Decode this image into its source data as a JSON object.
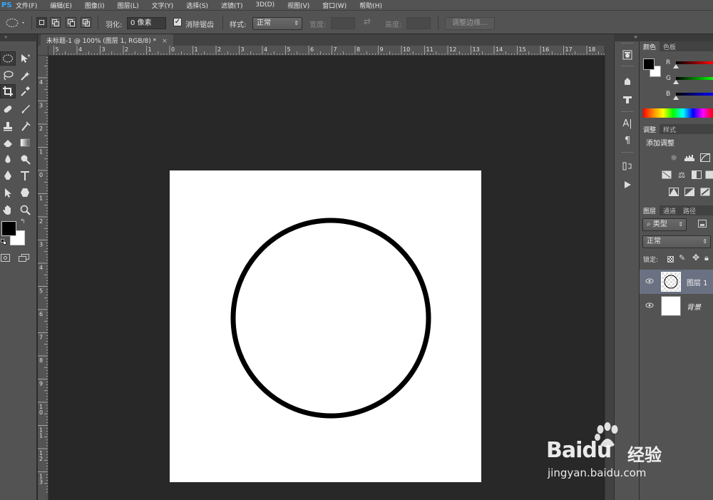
{
  "app": {
    "logo": "PS"
  },
  "menu": [
    "文件(F)",
    "编辑(E)",
    "图像(I)",
    "图层(L)",
    "文字(Y)",
    "选择(S)",
    "滤镜(T)",
    "3D(D)",
    "视图(V)",
    "窗口(W)",
    "帮助(H)"
  ],
  "options": {
    "feather_label": "羽化:",
    "feather_value": "0 像素",
    "antialias_label": "消除锯齿",
    "antialias_checked": true,
    "style_label": "样式:",
    "style_value": "正常",
    "width_label": "宽度:",
    "height_label": "高度:",
    "refine_button": "调整边缘..."
  },
  "document": {
    "tab_title": "未标题-1 @ 100% (图层 1, RGB/8) *",
    "close_glyph": "×",
    "ruler_h_ticks": [
      "5",
      "4",
      "3",
      "2",
      "1",
      "0",
      "1",
      "2",
      "3",
      "4",
      "5",
      "6",
      "7",
      "8",
      "9",
      "10",
      "11",
      "12",
      "13",
      "14",
      "15",
      "16",
      "17",
      "18"
    ],
    "ruler_v_ticks": [
      "5",
      "4",
      "3",
      "2",
      "1",
      "0",
      "1",
      "2",
      "3",
      "4",
      "5",
      "6",
      "7",
      "8",
      "9",
      "10",
      "11",
      "12",
      "13"
    ]
  },
  "panels": {
    "color_tabs": [
      "颜色",
      "色板"
    ],
    "channels": [
      "R",
      "G",
      "B"
    ],
    "adjust_tabs": [
      "调整",
      "样式"
    ],
    "add_adjustment": "添加调整",
    "layers_tabs": [
      "图层",
      "通道",
      "路径"
    ],
    "filter_kind": "类型",
    "blend_mode": "正常",
    "lock_label": "锁定:",
    "layers": [
      {
        "name": "图层 1",
        "selected": true
      },
      {
        "name": "背景",
        "selected": false
      }
    ]
  },
  "watermark": {
    "brand": "Baidu",
    "suffix": "经验",
    "url": "jingyan.baidu.com"
  },
  "colors": {
    "foreground": "#000000",
    "background": "#ffffff",
    "canvas_bg": "#282828",
    "ui_bg": "#535353",
    "selected_layer": "#6a7182"
  }
}
